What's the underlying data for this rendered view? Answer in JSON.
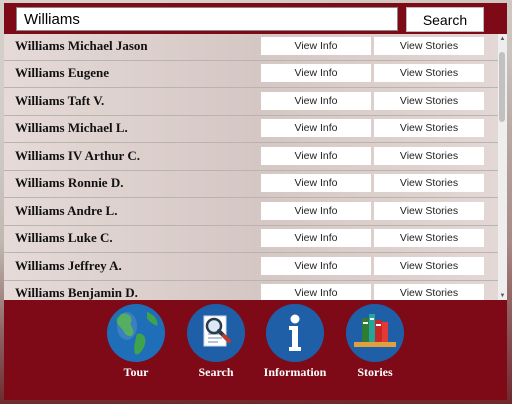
{
  "search": {
    "query": "Williams",
    "button_label": "Search"
  },
  "results": [
    {
      "name": "Williams Michael Jason",
      "info_label": "View Info",
      "stories_label": "View Stories"
    },
    {
      "name": "Williams Eugene",
      "info_label": "View Info",
      "stories_label": "View Stories"
    },
    {
      "name": "Williams Taft V.",
      "info_label": "View Info",
      "stories_label": "View Stories"
    },
    {
      "name": "Williams Michael L.",
      "info_label": "View Info",
      "stories_label": "View Stories"
    },
    {
      "name": "Williams IV Arthur C.",
      "info_label": "View Info",
      "stories_label": "View Stories"
    },
    {
      "name": "Williams Ronnie D.",
      "info_label": "View Info",
      "stories_label": "View Stories"
    },
    {
      "name": "Williams Andre L.",
      "info_label": "View Info",
      "stories_label": "View Stories"
    },
    {
      "name": "Williams Luke C.",
      "info_label": "View Info",
      "stories_label": "View Stories"
    },
    {
      "name": "Williams Jeffrey A.",
      "info_label": "View Info",
      "stories_label": "View Stories"
    },
    {
      "name": "Williams Benjamin D.",
      "info_label": "View Info",
      "stories_label": "View Stories"
    }
  ],
  "nav": [
    {
      "label": "Tour",
      "icon": "globe-icon"
    },
    {
      "label": "Search",
      "icon": "magnifier-document-icon"
    },
    {
      "label": "Information",
      "icon": "info-icon"
    },
    {
      "label": "Stories",
      "icon": "books-icon"
    }
  ],
  "colors": {
    "frame": "#7e0a18",
    "icon_circle": "#1f5fa8"
  }
}
